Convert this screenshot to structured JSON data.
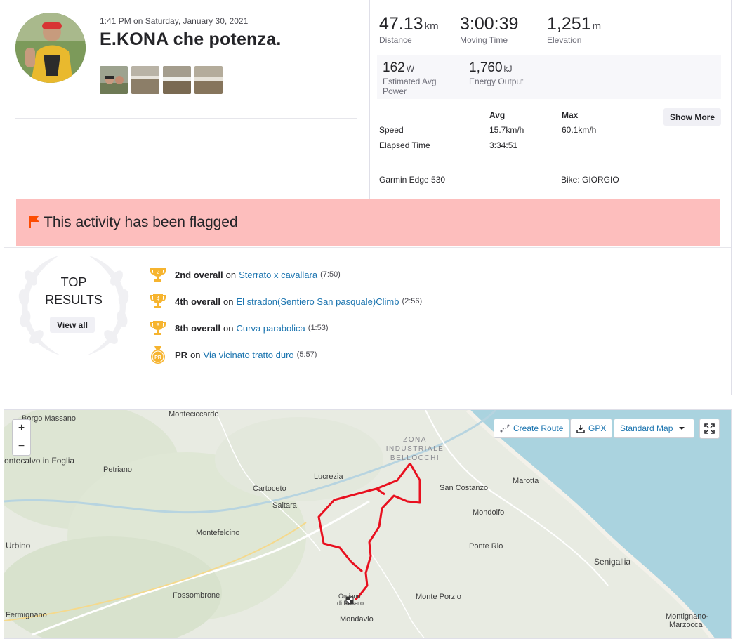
{
  "activity": {
    "datetime": "1:41 PM on Saturday, January 30, 2021",
    "title": "E.KONA che potenza.",
    "photos": [
      "photo-1",
      "photo-2",
      "photo-3",
      "photo-4"
    ]
  },
  "stats": {
    "distance": {
      "value": "47.13",
      "unit": "km",
      "label": "Distance"
    },
    "moving_time": {
      "value": "3:00:39",
      "unit": "",
      "label": "Moving Time"
    },
    "elevation": {
      "value": "1,251",
      "unit": "m",
      "label": "Elevation"
    },
    "power": {
      "value": "162",
      "unit": "W",
      "label_line1": "Estimated Avg",
      "label_line2": "Power"
    },
    "energy": {
      "value": "1,760",
      "unit": "kJ",
      "label": "Energy Output"
    }
  },
  "details_table": {
    "col_avg": "Avg",
    "col_max": "Max",
    "rows": [
      {
        "label": "Speed",
        "avg": "15.7km/h",
        "max": "60.1km/h"
      },
      {
        "label": "Elapsed Time",
        "avg": "3:34:51",
        "max": ""
      }
    ],
    "show_more_label": "Show More"
  },
  "gear": {
    "device": "Garmin Edge 530",
    "bike": "Bike: GIORGIO"
  },
  "flag_message": "This activity has been flagged",
  "top_results": {
    "heading_line1": "TOP",
    "heading_line2": "RESULTS",
    "view_all_label": "View all",
    "items": [
      {
        "badge": "2",
        "rank": "2nd overall",
        "on": "on",
        "segment": "Sterrato x cavallara",
        "time": "(7:50)"
      },
      {
        "badge": "4",
        "rank": "4th overall",
        "on": "on",
        "segment": "El stradon(Sentiero San pasquale)Climb",
        "time": "(2:56)"
      },
      {
        "badge": "8",
        "rank": "8th overall",
        "on": "on",
        "segment": "Curva parabolica",
        "time": "(1:53)"
      },
      {
        "badge": "PR",
        "rank": "PR",
        "on": "on",
        "segment": "Via vicinato tratto duro",
        "time": "(5:57)"
      }
    ]
  },
  "map": {
    "zoom_in": "+",
    "zoom_out": "−",
    "create_route_label": "Create Route",
    "gpx_label": "GPX",
    "map_type_label": "Standard Map",
    "zone_label_1": "ZONA",
    "zone_label_2": "INDUSTRIALE",
    "zone_label_3": "BELLOCCHI",
    "places": {
      "borgo_massano": "Borgo Massano",
      "monteciccardo": "Monteciccardo",
      "montecalvo": "ontecalvo in Foglia",
      "petriano": "Petriano",
      "lucrezia": "Lucrezia",
      "cartoceto": "Cartoceto",
      "saltara": "Saltara",
      "san_costanzo": "San Costanzo",
      "marotta": "Marotta",
      "mondolfo": "Mondolfo",
      "urbino": "Urbino",
      "montefelcino": "Montefelcino",
      "ponte_rio": "Ponte Rio",
      "senigallia": "Senigallia",
      "fossombrone": "Fossombrone",
      "orciano": "Orciano",
      "di_pesaro": "di Pesaro",
      "monte_porzio": "Monte Porzio",
      "fermignano": "Fermignano",
      "mondavio": "Mondavio",
      "montignano": "Montignano-",
      "marzocca": "Marzocca"
    },
    "route_color": "#e8101f",
    "sea_color": "#aad3df"
  },
  "colors": {
    "flag_bg": "#fdbebd",
    "flag_icon": "#fc4c02",
    "link": "#1c75b0",
    "trophy_gold": "#f6b42f"
  }
}
